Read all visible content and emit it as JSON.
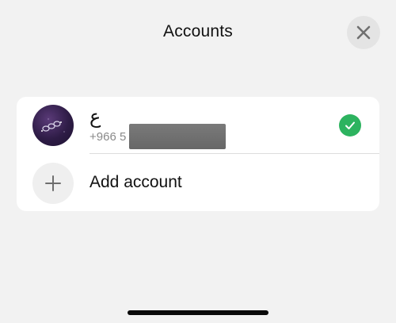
{
  "header": {
    "title": "Accounts",
    "close_icon": "close-icon"
  },
  "accounts": [
    {
      "name": "ع",
      "phone": "+966 5",
      "selected": true,
      "status_icon": "checkmark-circle-icon",
      "status_color": "#2db35f"
    }
  ],
  "add_account": {
    "label": "Add account",
    "icon": "plus-icon"
  },
  "colors": {
    "background": "#f2f2f2",
    "card": "#ffffff",
    "accent_check": "#2db35f"
  }
}
